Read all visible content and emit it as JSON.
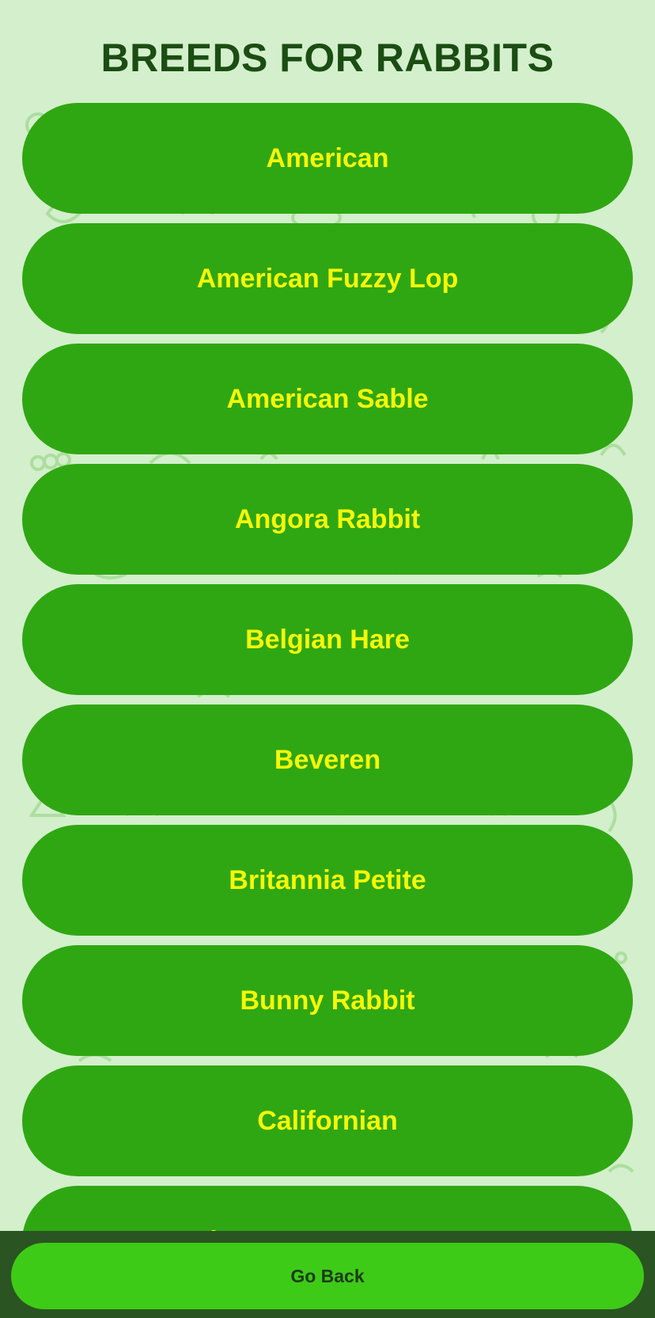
{
  "screen": {
    "title": "BREEDS FOR RABBITS"
  },
  "breeds": [
    {
      "label": "American"
    },
    {
      "label": "American Fuzzy Lop"
    },
    {
      "label": "American Sable"
    },
    {
      "label": "Angora Rabbit"
    },
    {
      "label": "Belgian Hare"
    },
    {
      "label": "Beveren"
    },
    {
      "label": "Britannia Petite"
    },
    {
      "label": "Bunny Rabbit"
    },
    {
      "label": "Californian"
    },
    {
      "label": "Champagne D'Argent"
    }
  ],
  "footer": {
    "go_back_label": "Go Back"
  },
  "colors": {
    "background": "#d3efcc",
    "title": "#1b4d13",
    "button_fill": "#2fa712",
    "button_text": "#f4f70a",
    "footer_bar": "#2a5421",
    "go_back_fill": "#3dcb18",
    "go_back_text": "#1d3a18"
  },
  "icons": {
    "background_pattern": "vegetable-doodle-pattern-icon"
  }
}
